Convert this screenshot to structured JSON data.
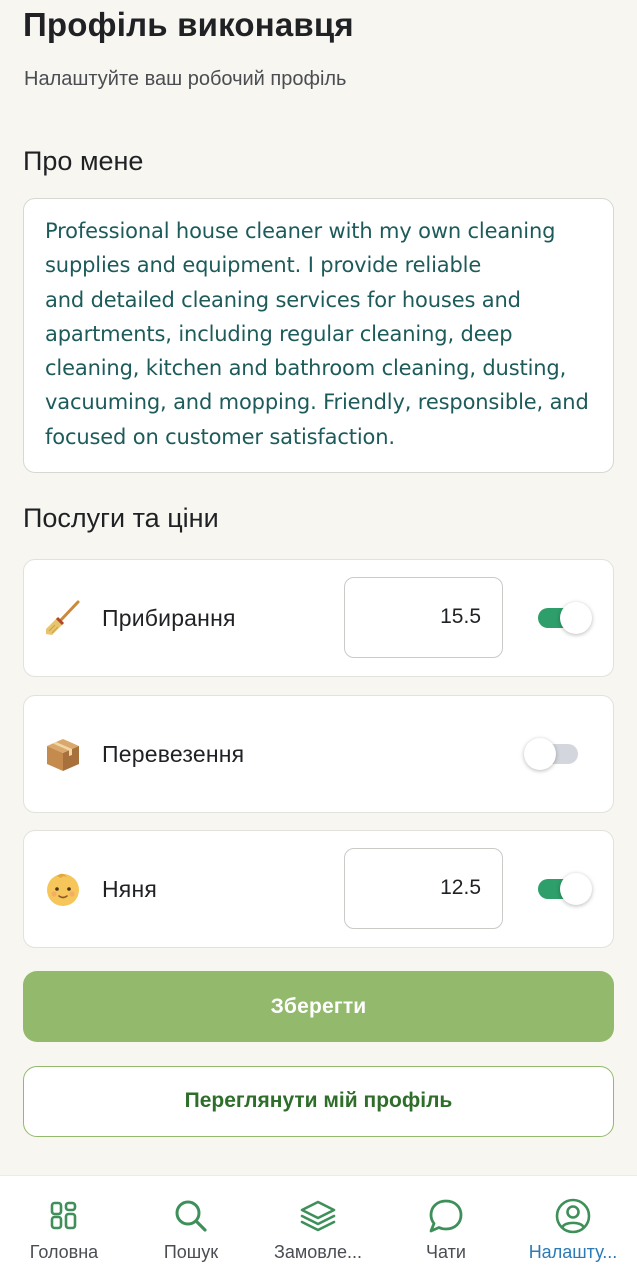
{
  "header": {
    "title": "Профіль виконавця",
    "subtitle": "Налаштуйте ваш робочий профіль"
  },
  "about": {
    "title": "Про мене",
    "lines": [
      "Professional house cleaner with my own cleaning",
      "supplies and equipment. I provide reliable",
      "and detailed cleaning services for houses and",
      "apartments, including regular cleaning, deep",
      "cleaning, kitchen and bathroom cleaning, dusting,",
      "vacuuming, and mopping. Friendly, responsible, and",
      "focused on customer satisfaction."
    ]
  },
  "services": {
    "title": "Послуги та ціни",
    "items": [
      {
        "icon": "broom-icon",
        "label": "Прибирання",
        "price": "15.5",
        "enabled": true
      },
      {
        "icon": "box-icon",
        "label": "Перевезення",
        "price": "",
        "enabled": false
      },
      {
        "icon": "baby-icon",
        "label": "Няня",
        "price": "12.5",
        "enabled": true
      }
    ]
  },
  "actions": {
    "save_label": "Зберегти",
    "view_profile_label": "Переглянути мій профіль"
  },
  "nav": {
    "items": [
      {
        "icon": "grid-icon",
        "label": "Головна"
      },
      {
        "icon": "search-icon",
        "label": "Пошук"
      },
      {
        "icon": "layers-icon",
        "label": "Замовле..."
      },
      {
        "icon": "chat-icon",
        "label": "Чати"
      },
      {
        "icon": "user-circle-icon",
        "label": "Налашту..."
      }
    ],
    "active_index": 4
  },
  "colors": {
    "accent_green": "#93ba6c",
    "toggle_on": "#2e9e6a",
    "active_nav": "#2c7bb6",
    "about_text": "#1d5b5a"
  }
}
